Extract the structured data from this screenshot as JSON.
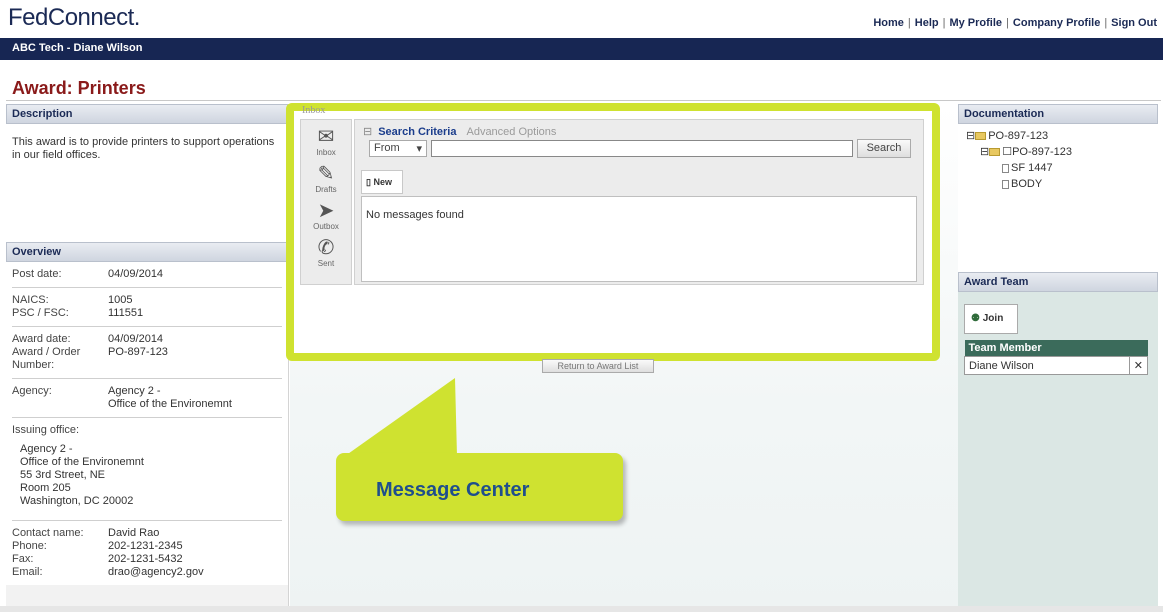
{
  "header": {
    "logo": "FedConnect.",
    "links": [
      "Home",
      "Help",
      "My Profile",
      "Company Profile",
      "Sign Out"
    ],
    "user": "ABC Tech - Diane Wilson"
  },
  "page_title": "Award: Printers",
  "description": {
    "heading": "Description",
    "text": "This award is to provide printers to support operations in our field offices."
  },
  "overview": {
    "heading": "Overview",
    "post_date_label": "Post date:",
    "post_date": "04/09/2014",
    "naics_label": "NAICS:",
    "naics": "1005",
    "psc_label": "PSC / FSC:",
    "psc": "111551",
    "award_date_label": "Award date:",
    "award_date": "04/09/2014",
    "order_number_label": "Award / Order Number:",
    "order_number": "PO-897-123",
    "agency_label": "Agency:",
    "agency_line1": "Agency 2 -",
    "agency_line2": "Office of the Environemnt",
    "issuing_label": "Issuing office:",
    "issuing_lines": [
      "Agency 2 -",
      "Office of the Environemnt",
      "55 3rd Street, NE",
      "Room 205",
      "Washington, DC 20002"
    ],
    "contact_label": "Contact name:",
    "contact": "David Rao",
    "phone_label": "Phone:",
    "phone": "202-1231-2345",
    "fax_label": "Fax:",
    "fax": "202-1231-5432",
    "email_label": "Email:",
    "email": "drao@agency2.gov"
  },
  "message_center": {
    "inbox_label": "Inbox",
    "folders": [
      "Inbox",
      "Drafts",
      "Outbox",
      "Sent"
    ],
    "toggle": "⊟",
    "search_criteria": "Search Criteria",
    "advanced_options": "Advanced Options",
    "from_option": "From",
    "search_button": "Search",
    "new_tab": "New",
    "no_messages": "No messages found"
  },
  "return_button": "Return to Award List",
  "callout": "Message Center",
  "documentation": {
    "heading": "Documentation",
    "tree": [
      "PO-897-123",
      "PO-897-123",
      "SF 1447",
      "BODY"
    ]
  },
  "award_team": {
    "heading": "Award Team",
    "join": "Join",
    "column": "Team Member",
    "members": [
      "Diane Wilson"
    ]
  }
}
